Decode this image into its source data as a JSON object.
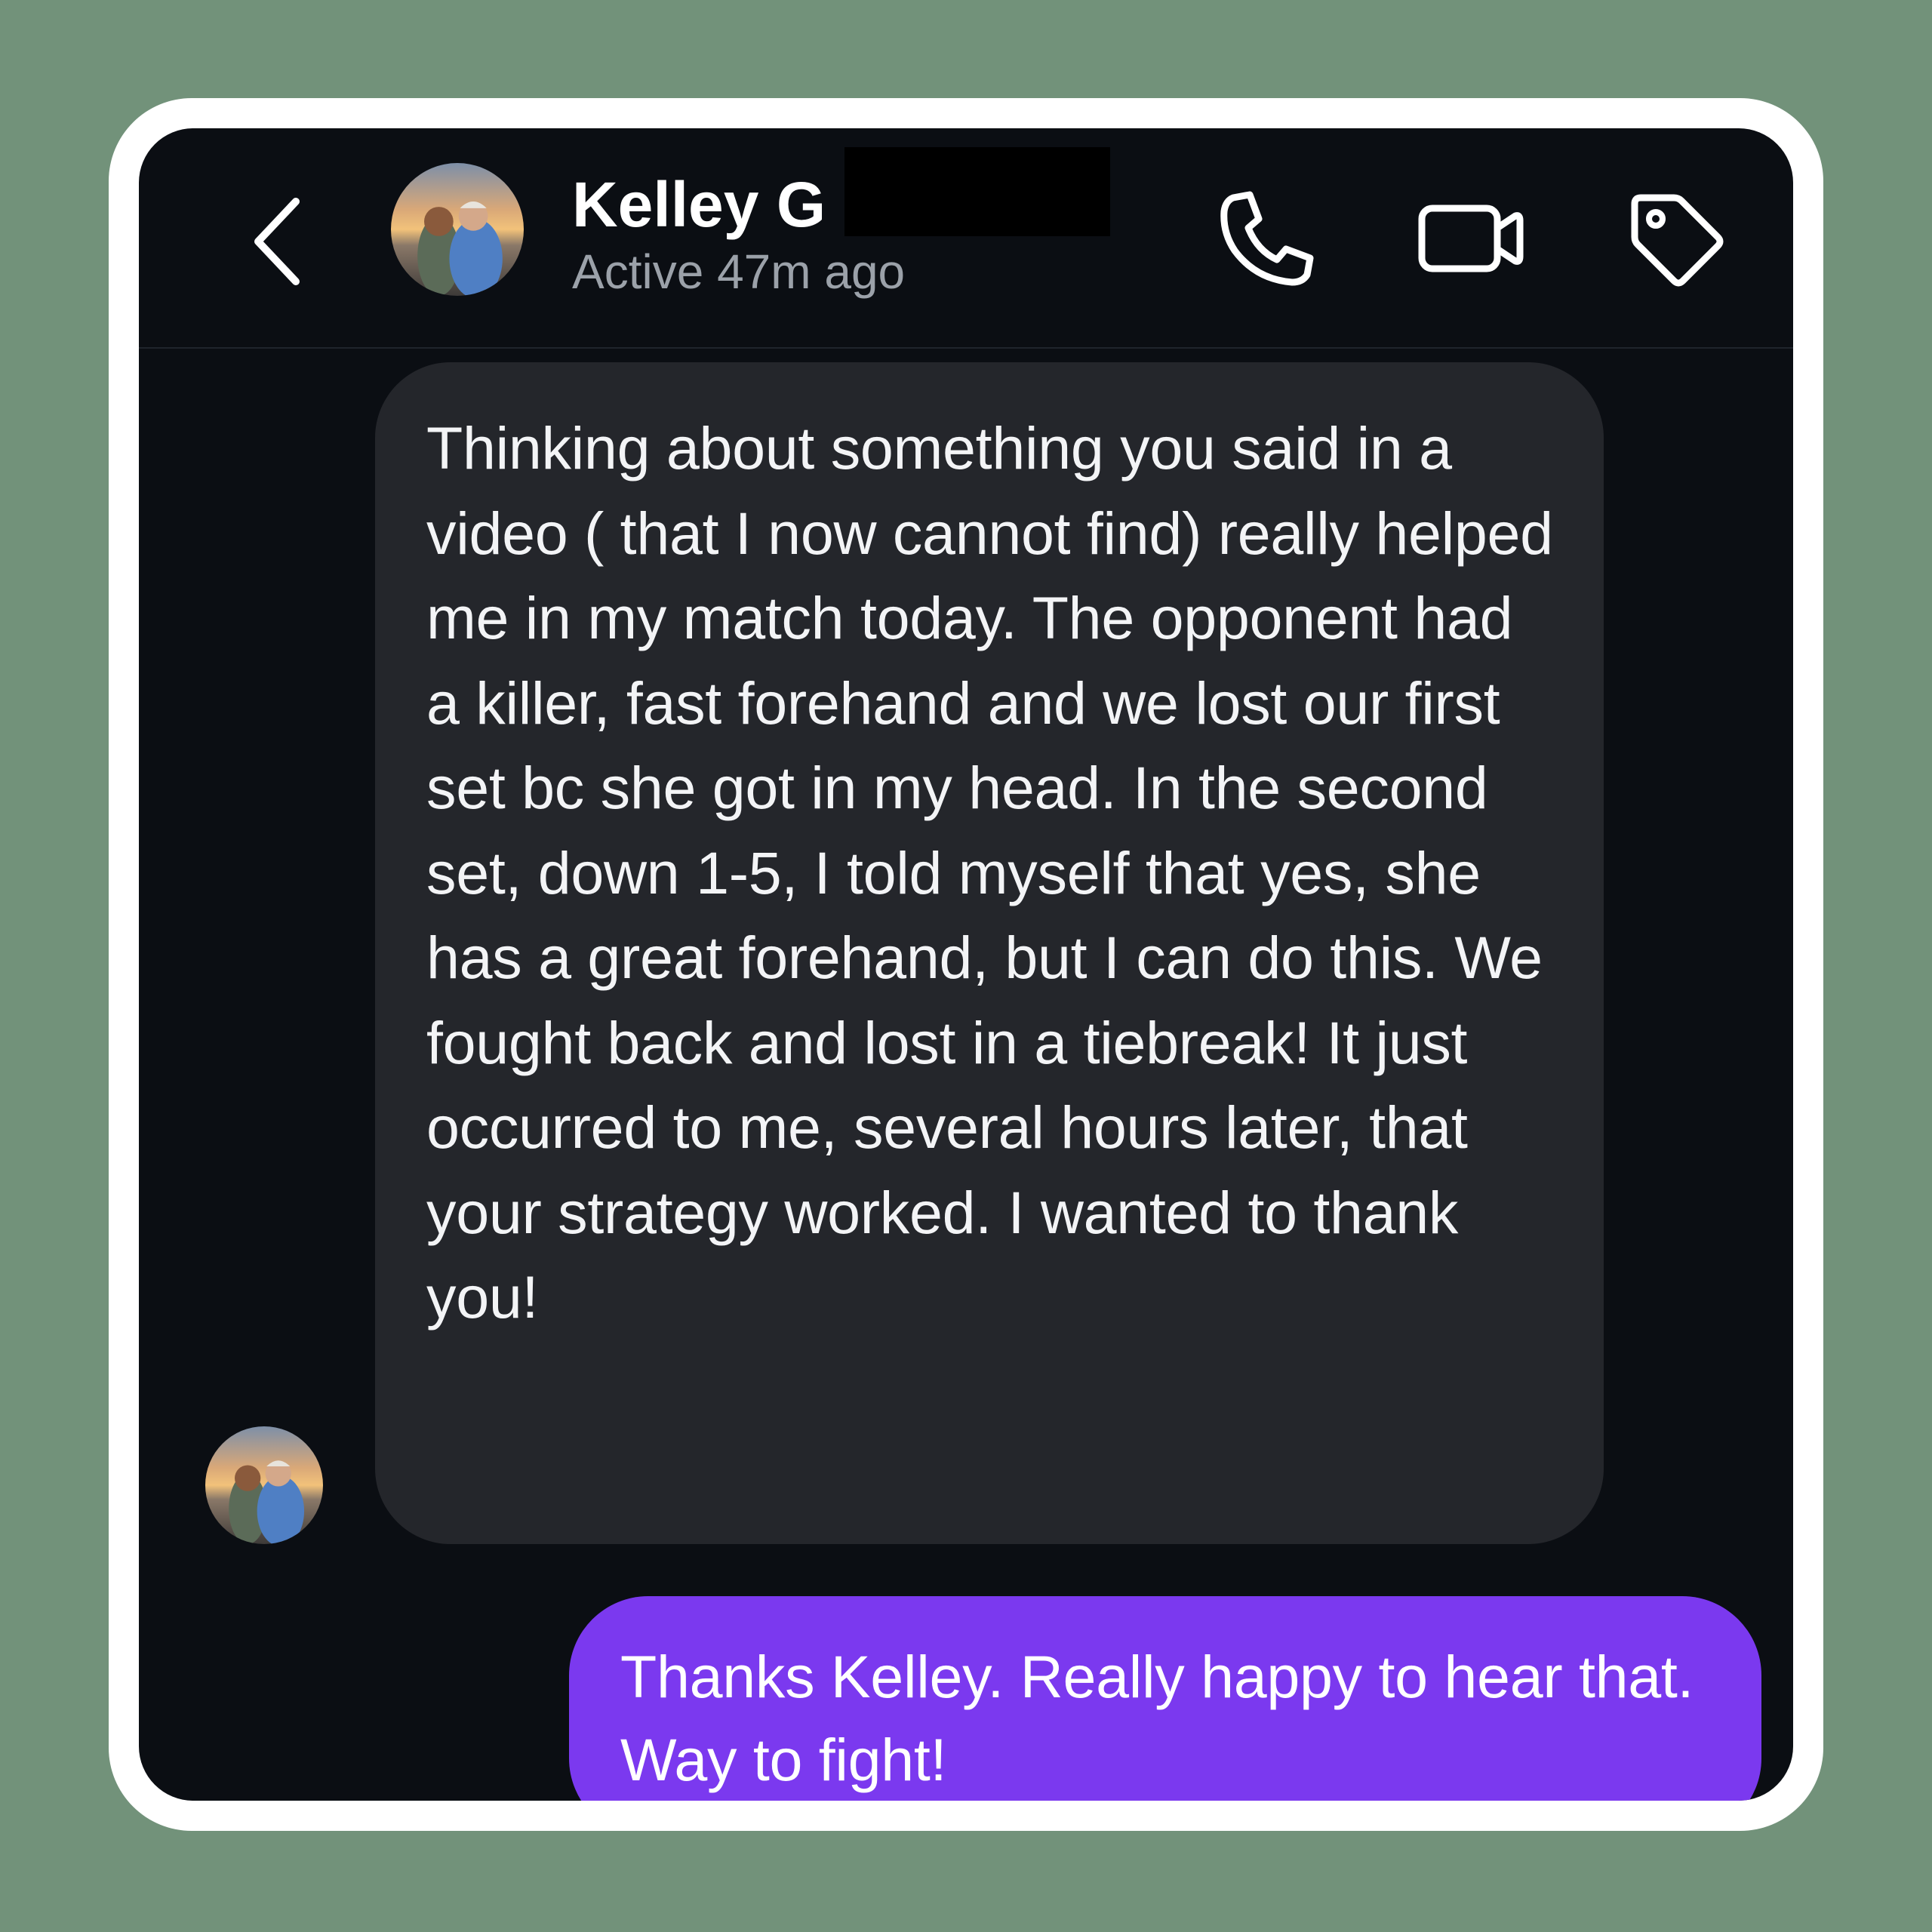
{
  "header": {
    "contact_name": "Kelley G",
    "status": "Active 47m ago",
    "icons": {
      "back": "chevron-left-icon",
      "call": "phone-icon",
      "video": "video-camera-icon",
      "tag": "tag-icon"
    }
  },
  "messages": [
    {
      "direction": "incoming",
      "text": "Thinking about something you said in a video ( that I now cannot find) really helped me in my match today. The opponent had a killer, fast forehand and we lost our first set bc she got in my head. In the second set, down 1-5, I told myself that yes, she has a great forehand, but I can do this. We fought back and lost in a tiebreak! It just occurred to me, several hours later, that your strategy worked. I wanted to thank you!"
    },
    {
      "direction": "outgoing",
      "text": "Thanks Kelley. Really happy to hear that. Way to fight!"
    }
  ],
  "colors": {
    "background": "#72927a",
    "screen": "#0b0e13",
    "incoming_bubble": "#24262b",
    "outgoing_bubble": "#7b39ef"
  }
}
